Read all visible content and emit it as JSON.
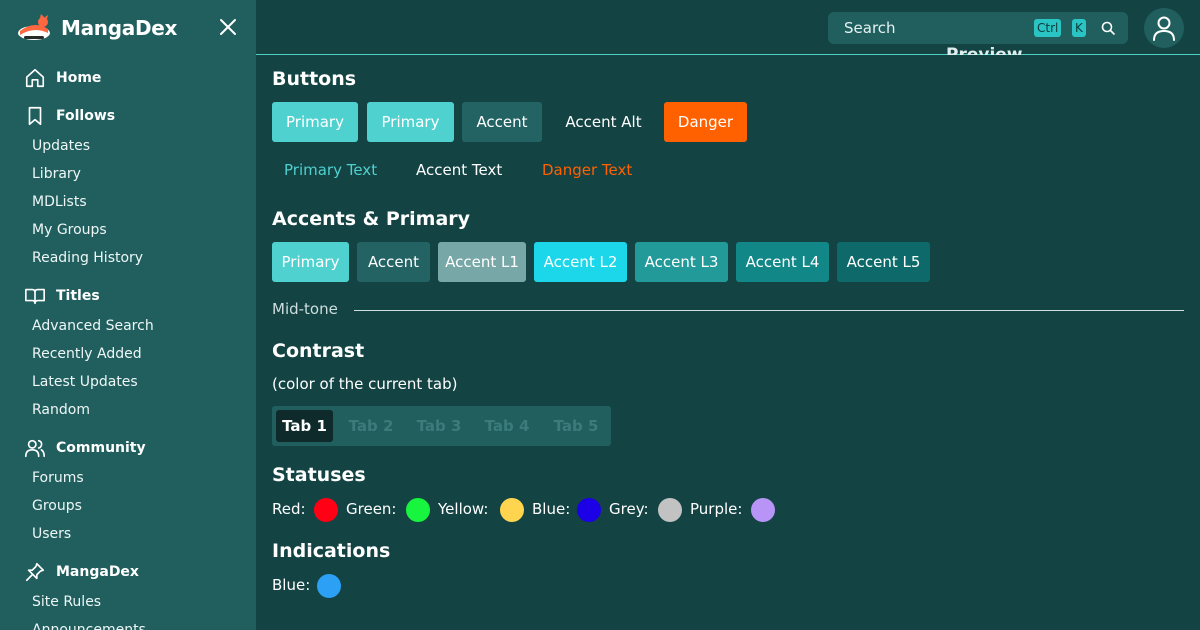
{
  "app": {
    "name": "MangaDex"
  },
  "sidebar": {
    "sections": [
      {
        "heading": "Home",
        "icon": "home-icon",
        "items": []
      },
      {
        "heading": "Follows",
        "icon": "bookmark-icon",
        "items": [
          "Updates",
          "Library",
          "MDLists",
          "My Groups",
          "Reading History"
        ]
      },
      {
        "heading": "Titles",
        "icon": "book-open-icon",
        "items": [
          "Advanced Search",
          "Recently Added",
          "Latest Updates",
          "Random"
        ]
      },
      {
        "heading": "Community",
        "icon": "users-icon",
        "items": [
          "Forums",
          "Groups",
          "Users"
        ]
      },
      {
        "heading": "MangaDex",
        "icon": "pin-icon",
        "items": [
          "Site Rules",
          "Announcements"
        ]
      }
    ]
  },
  "header": {
    "search_placeholder": "Search",
    "shortcut_ctrl": "Ctrl",
    "shortcut_key": "K",
    "preview_heading": "Preview"
  },
  "main": {
    "buttons_title": "Buttons",
    "buttons": [
      "Primary",
      "Primary",
      "Accent",
      "Accent Alt",
      "Danger"
    ],
    "text_buttons": [
      "Primary Text",
      "Accent Text",
      "Danger Text"
    ],
    "accents_title": "Accents & Primary",
    "accents": [
      "Primary",
      "Accent",
      "Accent L1",
      "Accent L2",
      "Accent L3",
      "Accent L4",
      "Accent L5"
    ],
    "midtone_label": "Mid-tone",
    "contrast_title": "Contrast",
    "contrast_subtitle": "(color of the current tab)",
    "tabs": [
      "Tab 1",
      "Tab 2",
      "Tab 3",
      "Tab 4",
      "Tab 5"
    ],
    "active_tab": "Tab 1",
    "statuses_title": "Statuses",
    "statuses": [
      {
        "label": "Red:",
        "color": "#ff0015"
      },
      {
        "label": "Green:",
        "color": "#18f53e"
      },
      {
        "label": "Yellow:",
        "color": "#ffd54f"
      },
      {
        "label": "Blue:",
        "color": "#1c00e6"
      },
      {
        "label": "Grey:",
        "color": "#c2c2c2"
      },
      {
        "label": "Purple:",
        "color": "#b794f6"
      }
    ],
    "indications_title": "Indications",
    "indications": [
      {
        "label": "Blue:",
        "color": "#2ba0f5"
      }
    ]
  },
  "colors": {
    "background": "#134343",
    "sidebar": "#215f5f",
    "primary": "#4fd1cf",
    "accent": "#236363",
    "accent_l1": "#78a7a7",
    "accent_l2": "#1bd7e9",
    "accent_l3": "#229a9a",
    "accent_l4": "#118787",
    "accent_l5": "#0e6a6a",
    "danger": "#ff6100"
  }
}
